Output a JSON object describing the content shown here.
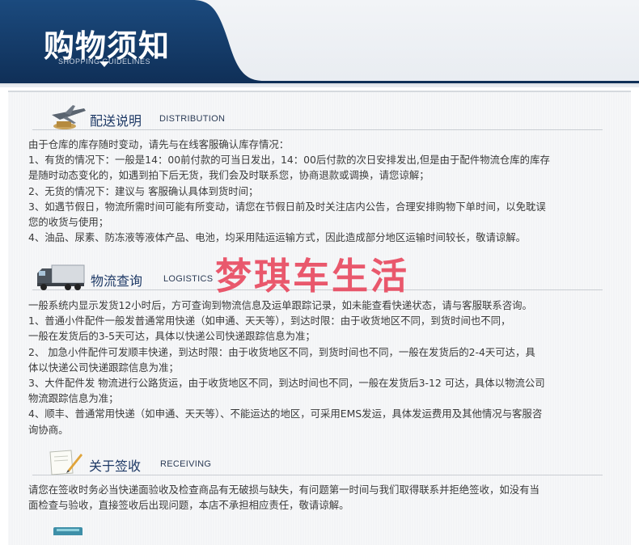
{
  "banner": {
    "title": "购物须知",
    "subtitle": "SHOPPING GUIDELINES"
  },
  "sections": [
    {
      "icon": "airplane-icon",
      "title": "配送说明",
      "subtitle": "DISTRIBUTION",
      "lines": [
        "由于仓库的库存随时变动，请先与在线客服确认库存情况：",
        "1、有货的情况下：一般是14：00前付款的可当日发出，14：00后付款的次日安排发出,但是由于配件物流仓库的库存",
        "是随时动态变化的，如遇到拍下后无货，我们会及时联系您，协商退款或调换，请您谅解；",
        "2、无货的情况下：建议与 客服确认具体到货时间；",
        "3、如遇节假日，物流所需时间可能有所变动，请您在节假日前及时关注店内公告，合理安排购物下单时间，以免耽误",
        "您的收货与使用；",
        "4、油品、尿素、防冻液等液体产品、电池，均采用陆运运输方式，因此造成部分地区运输时间较长，敬请谅解。"
      ]
    },
    {
      "icon": "truck-icon",
      "title": "物流查询",
      "subtitle": "LOGISTICS",
      "lines": [
        "一般系统内显示发货12小时后，方可查询到物流信息及运单跟踪记录，如未能查看快递状态，请与客服联系咨询。",
        "1、普通小件配件一般发普通常用快递（如申通、天天等），到达时限：由于收货地区不同，到货时间也不同，",
        "一般在发货后的3-5天可达，具体以快递公司快递跟踪信息为准；",
        "2、 加急小件配件可发顺丰快递，到达时限：由于收货地区不同，到货时间也不同，一般在发货后的2-4天可达，具",
        "体以快递公司快递跟踪信息为准；",
        "3、大件配件发 物流进行公路货运，由于收货地区不同，到达时间也不同，一般在发货后3-12 可达，具体以物流公司",
        "物流跟踪信息为准；",
        "4、顺丰、普通常用快递（如申通、天天等）、不能运达的地区，可采用EMS发运，具体发运费用及其他情况与客服咨",
        "询协商。"
      ]
    },
    {
      "icon": "signing-paper-icon",
      "title": "关于签收",
      "subtitle": "RECEIVING",
      "lines": [
        "请您在签收时务必当快递面验收及检查商品有无破损与缺失，有问题第一时间与我们取得联系并拒绝签收，如没有当",
        "面检查与验收，直接签收后出现问题，本店不承担相应责任，敬请谅解。"
      ]
    }
  ],
  "watermark": "梦琪车生活",
  "colors": {
    "banner_navy": "#143a66",
    "section_title": "#1f3a66",
    "watermark": "#e8435a"
  }
}
